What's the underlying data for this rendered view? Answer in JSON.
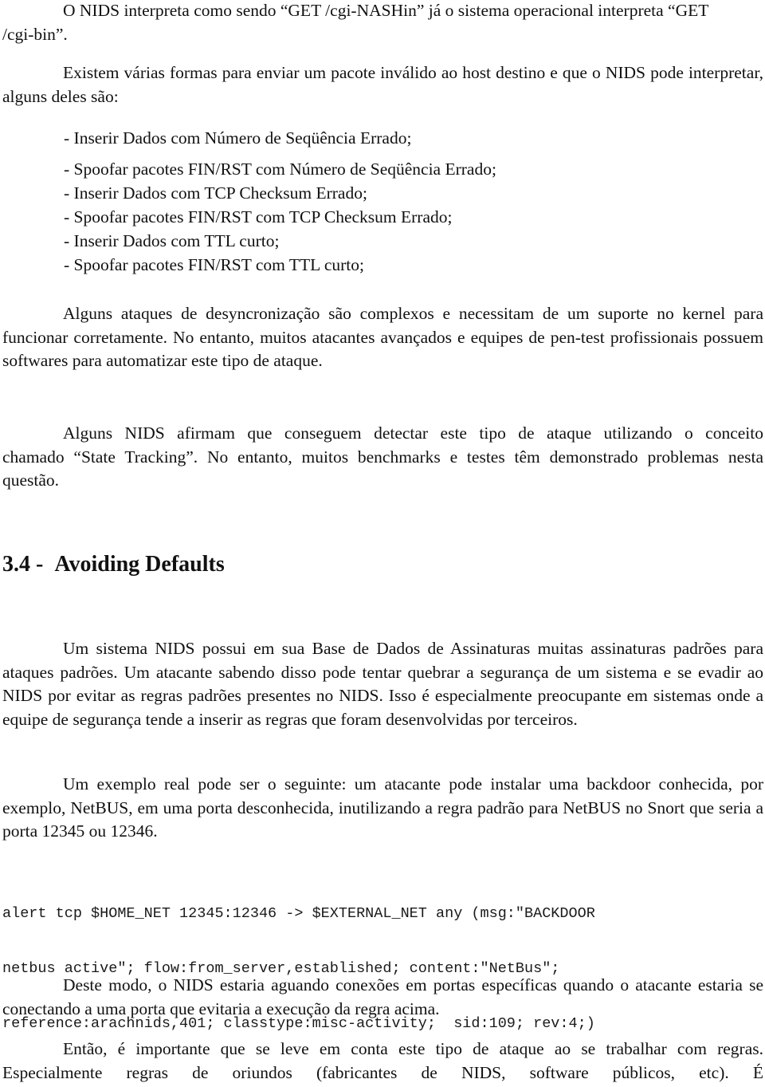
{
  "document": {
    "paragraphs": {
      "p1": "O NIDS interpreta como sendo “GET /cgi-NASHin” já o sistema operacional interpreta “GET /cgi-bin”.",
      "p2": "Existem várias formas para enviar um pacote inválido ao host destino e que o NIDS pode interpretar, alguns deles são:",
      "p3": "Alguns ataques de desyncronização são complexos e necessitam de um suporte no kernel para funcionar corretamente. No entanto, muitos atacantes avançados e equipes de pen-test profissionais possuem softwares para automatizar este tipo de ataque.",
      "p4": "Alguns NIDS afirmam que conseguem detectar este tipo de ataque utilizando o conceito chamado “State Tracking”. No entanto, muitos benchmarks e testes têm demonstrado problemas nesta questão.",
      "p5": "Um sistema NIDS possui em sua Base de Dados de Assinaturas muitas assinaturas padrões para ataques padrões. Um atacante sabendo disso pode tentar quebrar a segurança de um sistema e se evadir ao NIDS por evitar as regras padrões presentes no NIDS. Isso é especialmente preocupante em sistemas onde a equipe de segurança tende a inserir as regras que foram desenvolvidas por terceiros.",
      "p6": "Um exemplo real pode ser o seguinte: um atacante pode instalar uma backdoor conhecida, por exemplo, NetBUS, em uma porta desconhecida, inutilizando a regra padrão para NetBUS no Snort que seria a porta 12345 ou 12346.",
      "p7": "Deste modo, o NIDS estaria aguando conexões em portas específicas quando o atacante estaria se conectando a uma porta que evitaria a execução da regra acima.",
      "p8": "Então, é importante que se leve em conta este tipo de ataque ao se trabalhar com regras. Especialmente regras de oriundos (fabricantes de NIDS, software públicos, etc). É"
    },
    "list_items": [
      "- Inserir Dados com Número de Seqüência Errado;",
      "- Spoofar pacotes FIN/RST com Número de Seqüência Errado;",
      "- Inserir Dados com TCP Checksum Errado;",
      "- Spoofar pacotes FIN/RST com TCP Checksum Errado;",
      "- Inserir Dados com TTL curto;",
      "- Spoofar pacotes FIN/RST com TTL curto;"
    ],
    "section_heading": {
      "number": "3.4 -",
      "title": "Avoiding Defaults"
    },
    "code_lines": [
      "alert tcp $HOME_NET 12345:12346 -> $EXTERNAL_NET any (msg:\"BACKDOOR",
      "netbus active\"; flow:from_server,established; content:\"NetBus\";",
      "reference:arachnids,401; classtype:misc-activity;  sid:109; rev:4;)"
    ]
  }
}
